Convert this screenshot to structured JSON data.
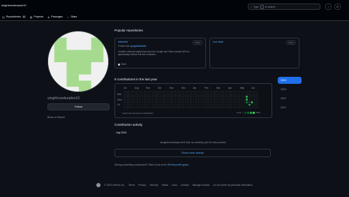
{
  "header": {
    "username": "singhlovedeepkm10",
    "search_placeholder": "Type",
    "search_key": "/",
    "search_suffix": "to search",
    "plus_label": "+",
    "chevron_label": "▾",
    "inbox_label": "⊡"
  },
  "tabs": [
    {
      "label": "Repositories",
      "count": "2",
      "icon": "repo-icon"
    },
    {
      "label": "Projects",
      "icon": "table-icon"
    },
    {
      "label": "Packages",
      "icon": "package-icon"
    },
    {
      "label": "Stars",
      "icon": "star-icon"
    }
  ],
  "profile": {
    "username": "singhlovedeepkm10",
    "follow_label": "Follow",
    "block_label": "Block or Report"
  },
  "popular": {
    "heading": "Popular repositories",
    "repos": [
      {
        "name": "dataclist",
        "badge": "Public",
        "forked_prefix": "Forked from",
        "forked_from": "google/dataclist",
        "description": "Creative retrieval engine that uses the Google and Yahoo search APIs to dynamically retrieve full text of articles...",
        "language": "Shell"
      },
      {
        "name": "ucn-data",
        "badge": "Public"
      }
    ]
  },
  "contrib": {
    "heading": "8 contributions in the last year",
    "months": [
      "Jul",
      "Aug",
      "Sep",
      "Oct",
      "Nov",
      "Dec",
      "Jan",
      "Feb",
      "Mar",
      "Apr",
      "May",
      "Jun"
    ],
    "days": [
      "Mon",
      "Wed",
      "Fri"
    ],
    "learn": "Learn how we count contributions",
    "less": "Less",
    "more": "More",
    "levels": [
      "#161b22",
      "#0e4429",
      "#006d32",
      "#26a641",
      "#39d353"
    ]
  },
  "years": [
    "2024",
    "2023",
    "2022",
    "2021"
  ],
  "activity": {
    "heading": "Contribution activity",
    "month": "July 2024",
    "none": "singhlovedeepkm10 has no activity yet for this period.",
    "more_btn": "Show more activity",
    "feedback_prefix": "Seeing something unexpected? Take a look at the",
    "feedback_link": "GitHub profile guide."
  },
  "footer": {
    "copyright": "© 2024 GitHub, Inc.",
    "links": [
      "Terms",
      "Privacy",
      "Security",
      "Status",
      "Docs",
      "Contact",
      "Manage cookies",
      "Do not share my personal information"
    ]
  }
}
